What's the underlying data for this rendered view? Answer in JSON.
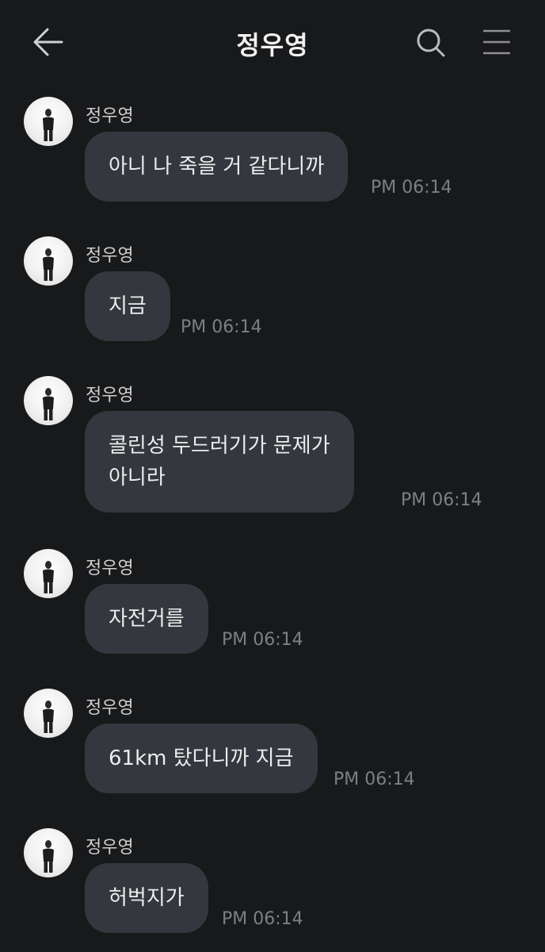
{
  "header": {
    "title": "정우영",
    "back_icon": "arrow-left-icon",
    "search_icon": "search-icon",
    "menu_icon": "hamburger-menu-icon"
  },
  "messages": [
    {
      "sender": "정우영",
      "text": "아니 나 죽을 거 같다니까",
      "time": "PM 06:14"
    },
    {
      "sender": "정우영",
      "text": "지금",
      "time": "PM 06:14"
    },
    {
      "sender": "정우영",
      "lines": [
        "콜린성 두드러기가 문제가",
        "아니라"
      ],
      "time": "PM 06:14"
    },
    {
      "sender": "정우영",
      "text": "자전거를",
      "time": "PM 06:14"
    },
    {
      "sender": "정우영",
      "text": "61km 탔다니까 지금",
      "time": "PM 06:14"
    },
    {
      "sender": "정우영",
      "text": "허벅지가",
      "time": "PM 06:14"
    }
  ],
  "colors": {
    "background": "#18191b",
    "bubble": "#34373d",
    "timestamp": "#7d7f84"
  }
}
